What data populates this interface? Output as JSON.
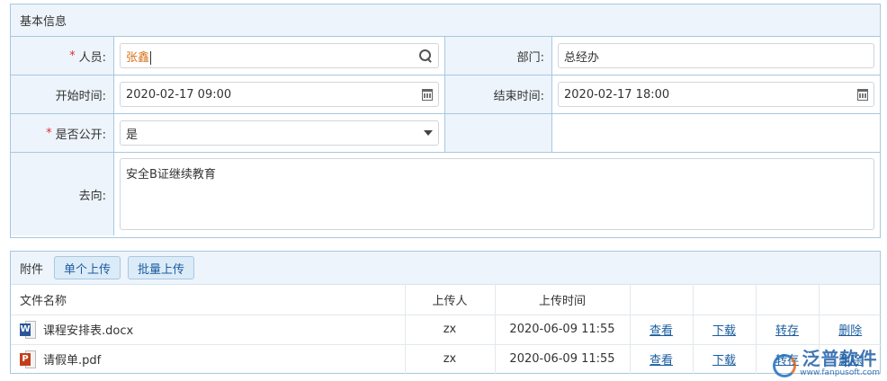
{
  "basic_info": {
    "title": "基本信息",
    "person": {
      "label": "人员:",
      "required_mark": "*",
      "value": "张鑫"
    },
    "department": {
      "label": "部门:",
      "value": "总经办"
    },
    "start_time": {
      "label": "开始时间:",
      "value": "2020-02-17 09:00"
    },
    "end_time": {
      "label": "结束时间:",
      "value": "2020-02-17 18:00"
    },
    "is_public": {
      "label": "是否公开:",
      "required_mark": "*",
      "value": "是"
    },
    "destination": {
      "label": "去向:",
      "value": "安全B证继续教育"
    }
  },
  "attachments": {
    "title": "附件",
    "upload_single": "单个上传",
    "upload_batch": "批量上传",
    "columns": [
      "文件名称",
      "上传人",
      "上传时间",
      "",
      "",
      "",
      ""
    ],
    "files": [
      {
        "icon": "word-doc-icon",
        "name": "课程安排表.docx",
        "uploader": "zx",
        "time": "2020-06-09 11:55",
        "view": "查看",
        "download": "下载",
        "transfer": "转存",
        "delete": "删除"
      },
      {
        "icon": "pdf-doc-icon",
        "name": "请假单.pdf",
        "uploader": "zx",
        "time": "2020-06-09 11:55",
        "view": "查看",
        "download": "下载",
        "transfer": "转存",
        "delete": "删除"
      }
    ]
  },
  "watermark": {
    "text": "泛普软件",
    "url": "www.fanpusoft.com"
  },
  "colors": {
    "border": "#a8c8e0",
    "header_bg": "#edf4fb",
    "link": "#1a5c9e",
    "required": "#e03030",
    "person_value": "#d9731a"
  }
}
